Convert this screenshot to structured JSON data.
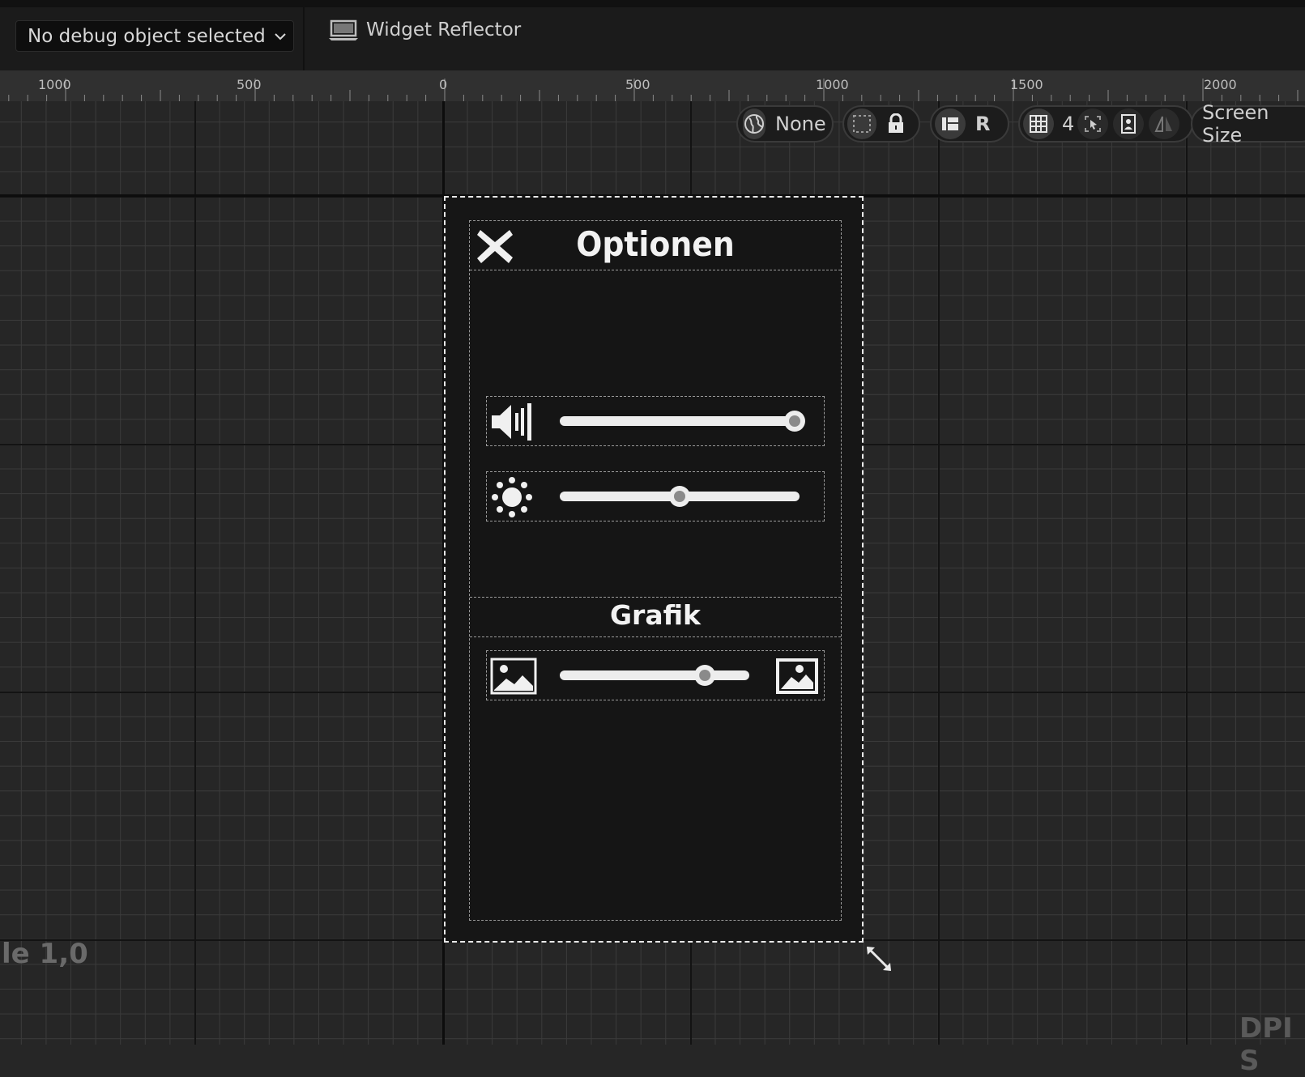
{
  "toolbar": {
    "debug_dropdown": "No debug object selected",
    "widget_reflector": "Widget Reflector"
  },
  "ruler": {
    "labels": [
      "1000",
      "500",
      "0",
      "500",
      "1000",
      "1500",
      "2000"
    ]
  },
  "viewport_toolbar": {
    "locale": "None",
    "respect_locks": "R",
    "grid_size": "4",
    "screen_size": "Screen Size"
  },
  "widget": {
    "title": "Optionen",
    "section_title": "Grafik",
    "volume_slider": 1.0,
    "brightness_slider": 0.5,
    "graphics_slider": 0.78
  },
  "overlay": {
    "scale_text": "le 1,0",
    "dpi_text": "DPI S"
  }
}
